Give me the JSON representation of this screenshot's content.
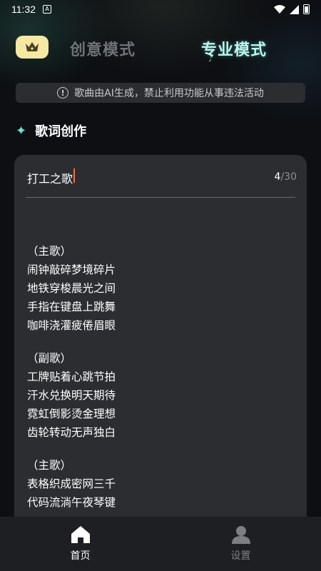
{
  "status_bar": {
    "time": "11:32",
    "app_icon_letter": "A"
  },
  "header": {
    "vip_icon": "crown-icon",
    "tabs": [
      {
        "label": "创意模式",
        "active": false
      },
      {
        "label": "专业模式",
        "active": true
      }
    ]
  },
  "notice": {
    "icon": "info-icon",
    "text": "歌曲由AI生成，禁止利用功能从事违法活动"
  },
  "section": {
    "icon": "sparkle-icon",
    "title": "歌词创作"
  },
  "editor": {
    "title_value": "打工之歌",
    "char_count_current": "4",
    "char_count_max": "/30",
    "lyrics": [
      [
        "（主歌）",
        "闹钟敲碎梦境碎片",
        "地铁穿梭晨光之间",
        "手指在键盘上跳舞",
        "咖啡浇灌疲倦眉眼"
      ],
      [
        "（副歌）",
        "工牌贴着心跳节拍",
        "汗水兑换明天期待",
        "霓虹倒影烫金理想",
        "齿轮转动无声独白"
      ],
      [
        "（主歌）",
        "表格织成密网三千",
        "代码流淌午夜琴键"
      ]
    ]
  },
  "bottom_nav": {
    "items": [
      {
        "label": "首页",
        "icon": "home-icon",
        "active": true
      },
      {
        "label": "设置",
        "icon": "user-icon",
        "active": false
      }
    ]
  },
  "colors": {
    "accent": "#6fe3d3",
    "vip_bg": "#f5e8a3",
    "card_bg": "#2b2d31",
    "caret": "#ff6a3d"
  }
}
